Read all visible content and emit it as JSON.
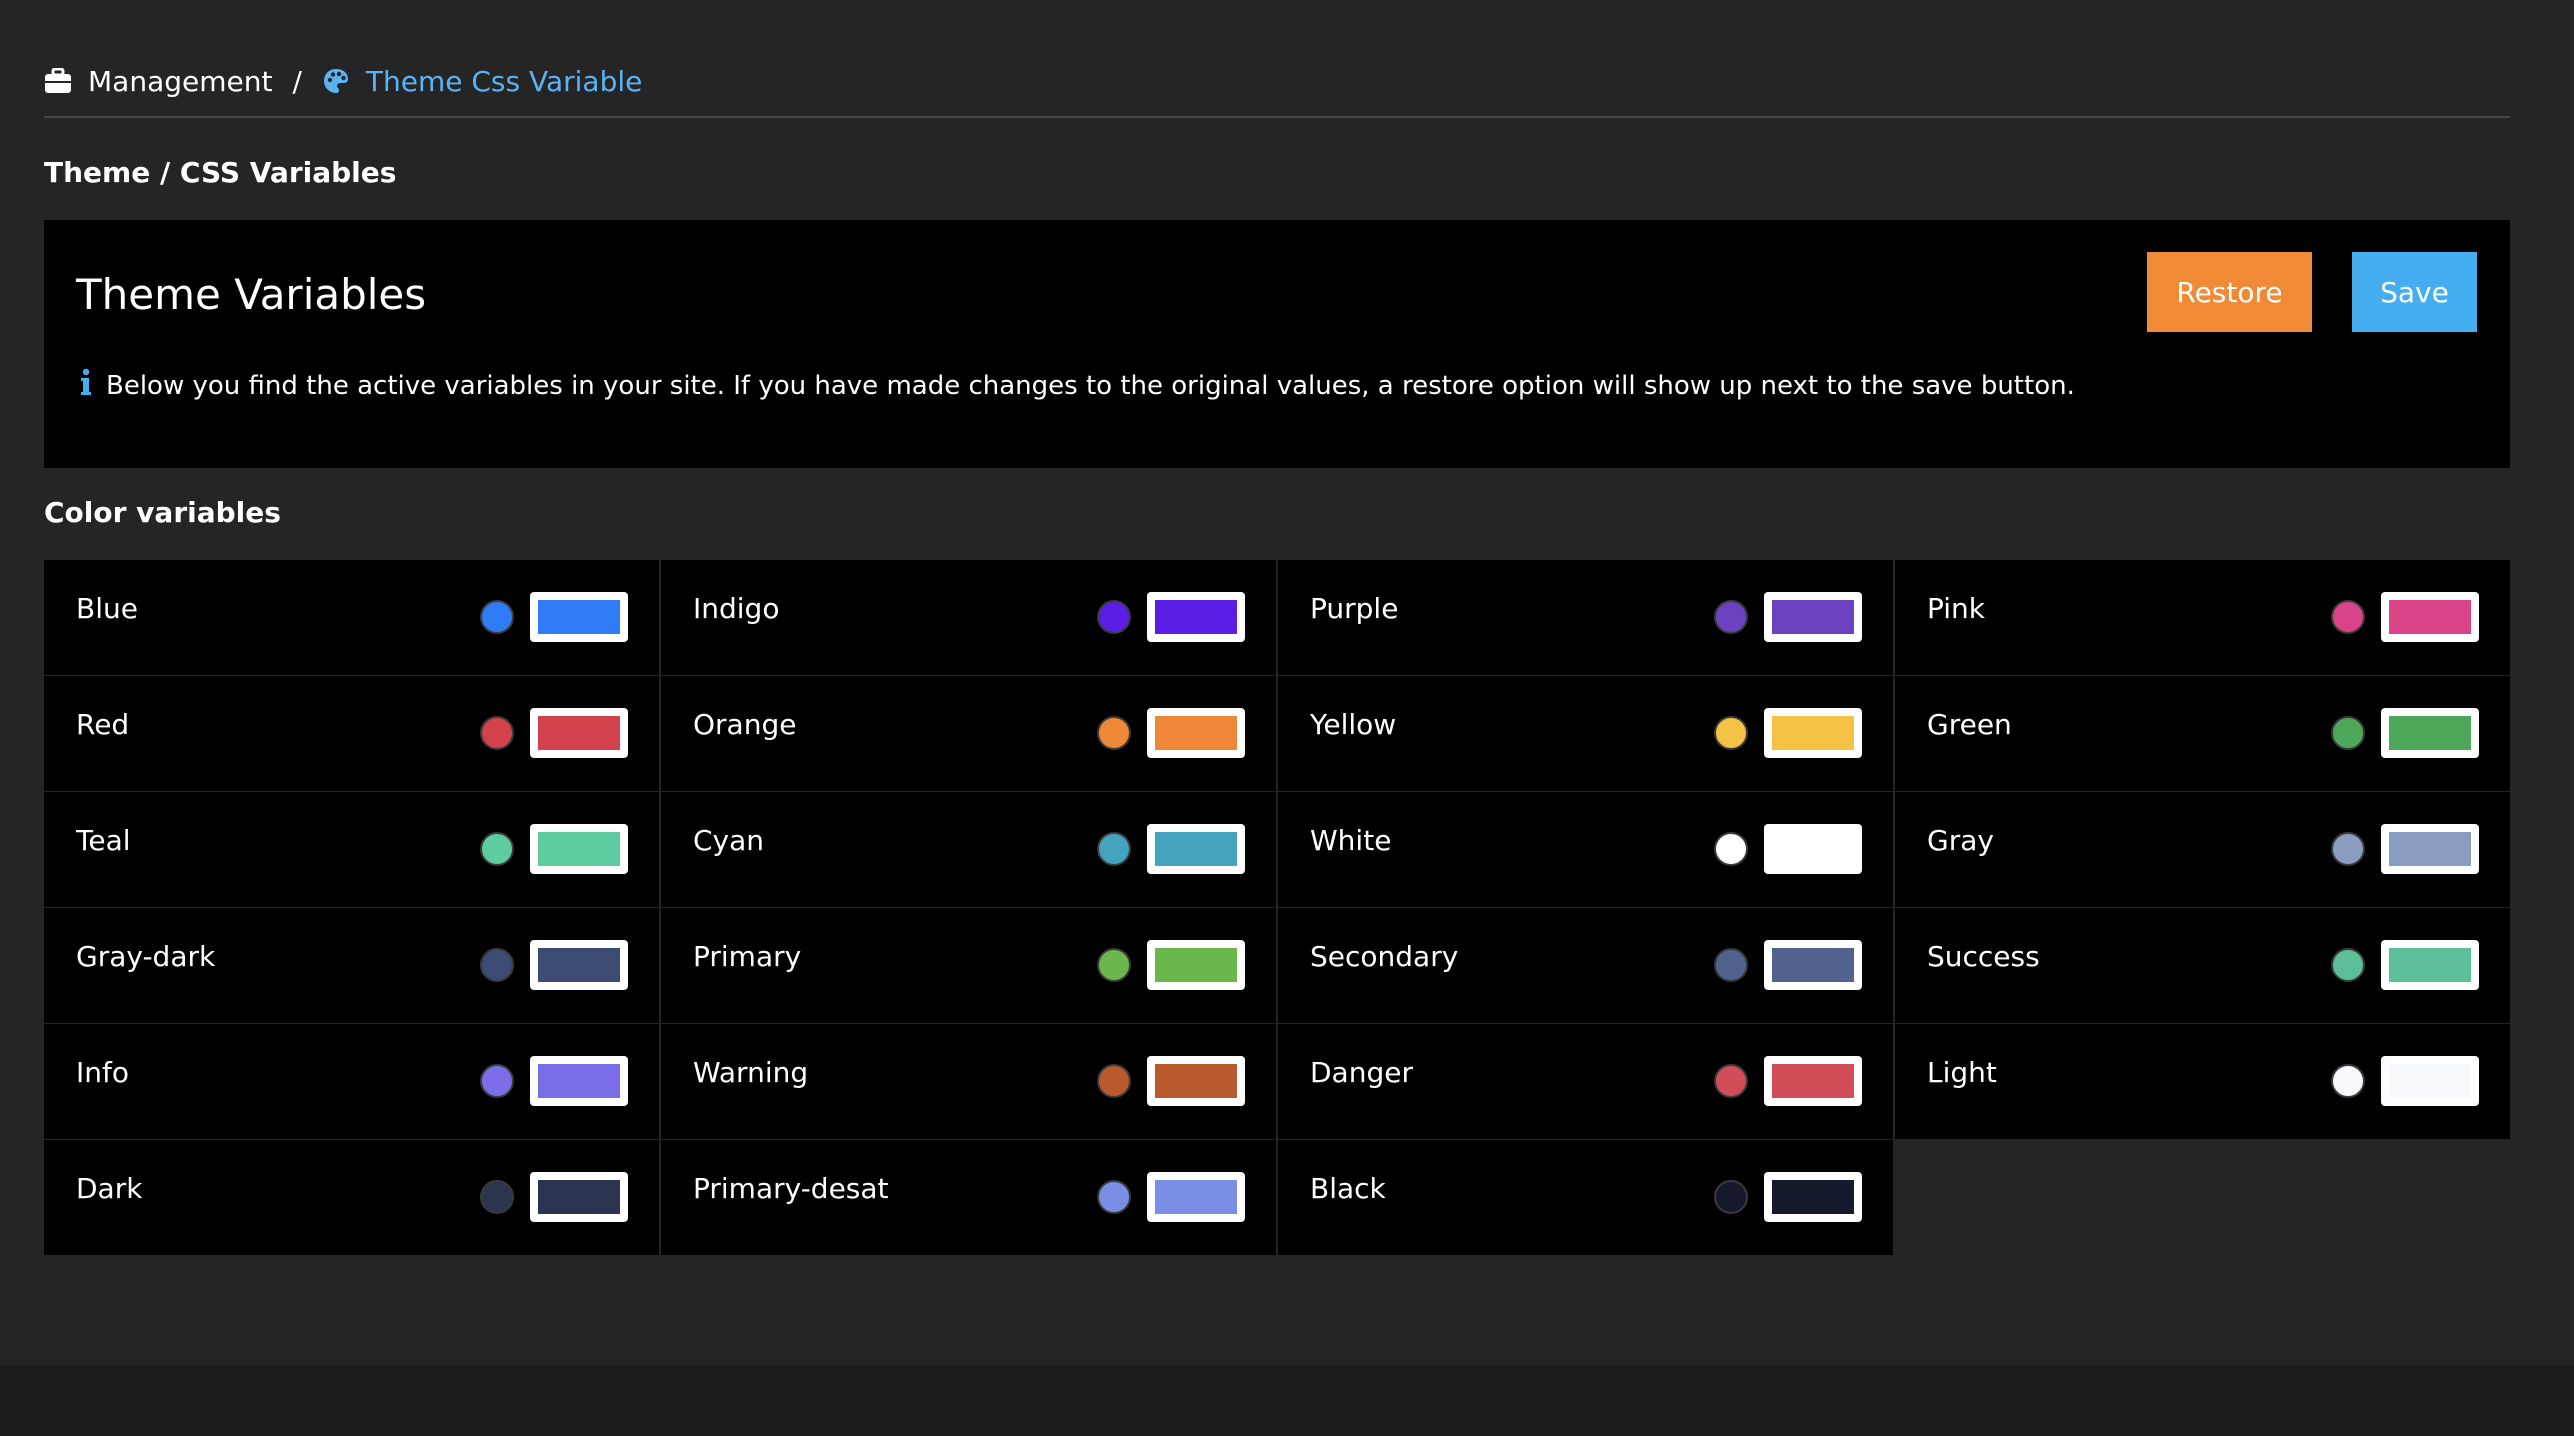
{
  "breadcrumb": {
    "items": [
      {
        "label": "Management",
        "icon": "briefcase-icon"
      },
      {
        "label": "Theme Css Variable",
        "icon": "palette-icon"
      }
    ],
    "separator": "/"
  },
  "section_theme_title": "Theme / CSS Variables",
  "header": {
    "title": "Theme Variables",
    "info_icon": "info-icon",
    "info_text": "Below you find the active variables in your site. If you have made changes to the original values, a restore option will show up next to the save button.",
    "restore_label": "Restore",
    "save_label": "Save"
  },
  "section_colors_title": "Color variables",
  "colors": [
    {
      "name": "Blue",
      "value": "#2f7cf6"
    },
    {
      "name": "Indigo",
      "value": "#5a1ee6"
    },
    {
      "name": "Purple",
      "value": "#6c42c2"
    },
    {
      "name": "Pink",
      "value": "#d84487"
    },
    {
      "name": "Red",
      "value": "#d1424c"
    },
    {
      "name": "Orange",
      "value": "#ee8737"
    },
    {
      "name": "Yellow",
      "value": "#f4c244"
    },
    {
      "name": "Green",
      "value": "#4ea85a"
    },
    {
      "name": "Teal",
      "value": "#5ecc9f"
    },
    {
      "name": "Cyan",
      "value": "#44a3bf"
    },
    {
      "name": "White",
      "value": "#ffffff"
    },
    {
      "name": "Gray",
      "value": "#8a9cc0"
    },
    {
      "name": "Gray-dark",
      "value": "#3d4c75"
    },
    {
      "name": "Primary",
      "value": "#6ab84c"
    },
    {
      "name": "Secondary",
      "value": "#52628f"
    },
    {
      "name": "Success",
      "value": "#5cbf97"
    },
    {
      "name": "Info",
      "value": "#7a6ee8"
    },
    {
      "name": "Warning",
      "value": "#b85a2d"
    },
    {
      "name": "Danger",
      "value": "#d14d58"
    },
    {
      "name": "Light",
      "value": "#f7f9fc"
    },
    {
      "name": "Dark",
      "value": "#2c3550"
    },
    {
      "name": "Primary-desat",
      "value": "#7b8ee6"
    },
    {
      "name": "Black",
      "value": "#141a2c"
    }
  ],
  "colors_meta": {
    "accent_link": "#5ab4f4",
    "restore_color": "#f08a35",
    "save_color": "#45aef0"
  }
}
